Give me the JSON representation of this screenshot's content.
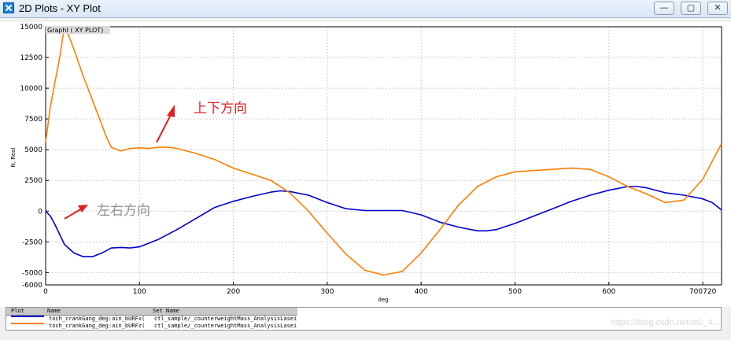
{
  "window": {
    "title": "2D Plots - XY Plot",
    "buttons": {
      "minimize": "—",
      "maximize": "▢",
      "close": "✕"
    }
  },
  "plot": {
    "graph_label": "GraphI ( XY PLOT)",
    "annotations": [
      {
        "text": "上下方向",
        "color": "#e02020"
      },
      {
        "text": "左右方向",
        "color": "#909090"
      }
    ],
    "arrow_color": "#e02020"
  },
  "legend": {
    "headers": {
      "plot": "Plot",
      "name": "Name",
      "set": "Set Name"
    },
    "rows": [
      {
        "color": "#0000cc",
        "name": "toch_crankGang_deg:ain_bURFx(",
        "set": "ctl_sample/_counterweightMass_AnalysisLasei"
      },
      {
        "color": "#ff7f00",
        "name": "toch_crankGang_deg:ain_bURFz(",
        "set": "ctl_sample/_counterweightMass_AnalysisLasei"
      }
    ]
  },
  "watermark": "https://blog.csdn.net/m0_4...",
  "chart_data": {
    "type": "line",
    "title": "",
    "xlabel": "deg",
    "ylabel": "N, Real",
    "xlim": [
      0,
      720
    ],
    "ylim": [
      -6000,
      15000
    ],
    "x_ticks": [
      0,
      100,
      200,
      300,
      400,
      500,
      600,
      700
    ],
    "x_tick_labels": [
      "0",
      "100",
      "200",
      "300",
      "400",
      "500",
      "600",
      "700720"
    ],
    "y_ticks": [
      -6000,
      -5000,
      -2500,
      0,
      2500,
      5000,
      7500,
      10000,
      12500,
      15000
    ],
    "y_tick_labels": [
      "-6000",
      "-5000",
      "-2500",
      "0",
      "2500",
      "5000",
      "7500",
      "10000",
      "12500",
      "15000"
    ],
    "grid": true,
    "series": [
      {
        "color": "#0000cc",
        "x": [
          0,
          5,
          10,
          20,
          30,
          40,
          50,
          60,
          70,
          80,
          90,
          100,
          120,
          140,
          160,
          180,
          200,
          220,
          240,
          250,
          260,
          280,
          300,
          320,
          340,
          360,
          380,
          400,
          420,
          440,
          460,
          470,
          480,
          500,
          520,
          540,
          560,
          580,
          600,
          620,
          630,
          640,
          660,
          680,
          700,
          710,
          720
        ],
        "y": [
          0,
          -400,
          -1100,
          -2700,
          -3400,
          -3700,
          -3700,
          -3400,
          -3000,
          -2950,
          -3000,
          -2900,
          -2300,
          -1500,
          -600,
          300,
          800,
          1200,
          1550,
          1650,
          1600,
          1300,
          700,
          200,
          50,
          50,
          50,
          -300,
          -900,
          -1300,
          -1600,
          -1600,
          -1500,
          -1000,
          -400,
          200,
          800,
          1300,
          1700,
          2000,
          2000,
          1900,
          1500,
          1300,
          1000,
          700,
          100
        ]
      },
      {
        "color": "#ff7f00",
        "x": [
          0,
          5,
          10,
          15,
          20,
          25,
          30,
          40,
          50,
          60,
          65,
          70,
          80,
          90,
          100,
          110,
          120,
          130,
          140,
          160,
          180,
          200,
          220,
          240,
          260,
          280,
          300,
          320,
          340,
          360,
          380,
          400,
          420,
          440,
          460,
          480,
          500,
          520,
          540,
          560,
          580,
          600,
          620,
          640,
          660,
          680,
          700,
          720
        ],
        "y": [
          5600,
          8500,
          10500,
          12500,
          15000,
          14200,
          13200,
          11000,
          9000,
          7000,
          6000,
          5200,
          4900,
          5100,
          5150,
          5100,
          5200,
          5200,
          5100,
          4700,
          4200,
          3500,
          3000,
          2500,
          1500,
          0,
          -1800,
          -3500,
          -4800,
          -5200,
          -4900,
          -3400,
          -1500,
          500,
          2000,
          2800,
          3200,
          3300,
          3400,
          3500,
          3400,
          2800,
          2000,
          1400,
          700,
          900,
          2600,
          5500
        ]
      }
    ]
  }
}
